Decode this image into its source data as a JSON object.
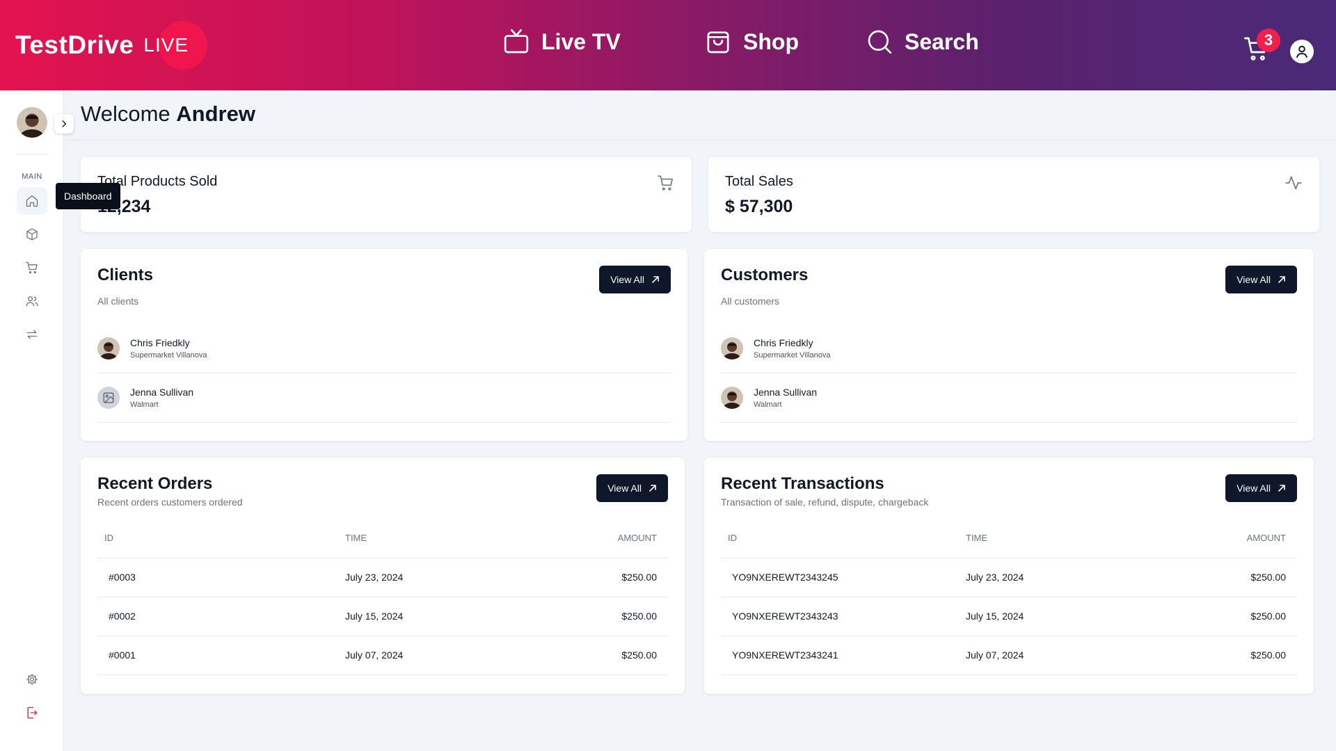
{
  "header": {
    "logo_main": "TestDrive",
    "logo_live": "LIVE",
    "nav": [
      {
        "label": "Live TV",
        "icon": "tv-icon"
      },
      {
        "label": "Shop",
        "icon": "shopping-bag-icon"
      },
      {
        "label": "Search",
        "icon": "search-icon"
      }
    ],
    "cart_count": "3"
  },
  "sidebar": {
    "section_label": "MAIN",
    "tooltip": "Dashboard",
    "items": [
      {
        "name": "home-icon"
      },
      {
        "name": "box-icon"
      },
      {
        "name": "cart-icon"
      },
      {
        "name": "users-icon"
      },
      {
        "name": "transfer-icon"
      },
      {
        "name": "settings-icon"
      },
      {
        "name": "logout-icon"
      }
    ]
  },
  "welcome": {
    "greeting": "Welcome",
    "name": "Andrew"
  },
  "stats": [
    {
      "title": "Total Products Sold",
      "value": "12,234",
      "icon": "cart-icon"
    },
    {
      "title": "Total Sales",
      "value": "$ 57,300",
      "icon": "activity-icon"
    }
  ],
  "clients": {
    "title": "Clients",
    "subtitle": "All clients",
    "view_all": "View All",
    "items": [
      {
        "name": "Chris Friedkly",
        "org": "Supermarket Villanova"
      },
      {
        "name": "Jenna Sullivan",
        "org": "Walmart"
      }
    ]
  },
  "customers": {
    "title": "Customers",
    "subtitle": "All customers",
    "view_all": "View All",
    "items": [
      {
        "name": "Chris Friedkly",
        "org": "Supermarket Villanova"
      },
      {
        "name": "Jenna Sullivan",
        "org": "Walmart"
      }
    ]
  },
  "orders": {
    "title": "Recent Orders",
    "subtitle": "Recent orders customers ordered",
    "view_all": "View All",
    "columns": [
      "ID",
      "TIME",
      "AMOUNT"
    ],
    "rows": [
      {
        "id": "#0003",
        "time": "July 23, 2024",
        "amount": "$250.00"
      },
      {
        "id": "#0002",
        "time": "July 15, 2024",
        "amount": "$250.00"
      },
      {
        "id": "#0001",
        "time": "July 07, 2024",
        "amount": "$250.00"
      }
    ]
  },
  "transactions": {
    "title": "Recent Transactions",
    "subtitle": "Transaction of sale, refund, dispute, chargeback",
    "view_all": "View All",
    "columns": [
      "ID",
      "TIME",
      "AMOUNT"
    ],
    "rows": [
      {
        "id": "YO9NXEREWT2343245",
        "time": "July 23, 2024",
        "amount": "$250.00"
      },
      {
        "id": "YO9NXEREWT2343243",
        "time": "July 15, 2024",
        "amount": "$250.00"
      },
      {
        "id": "YO9NXEREWT2343241",
        "time": "July 07, 2024",
        "amount": "$250.00"
      }
    ]
  },
  "colors": {
    "accent": "#e3134f",
    "header_end": "#4a2a78",
    "button": "#0f172a",
    "logout": "#e11d48"
  }
}
